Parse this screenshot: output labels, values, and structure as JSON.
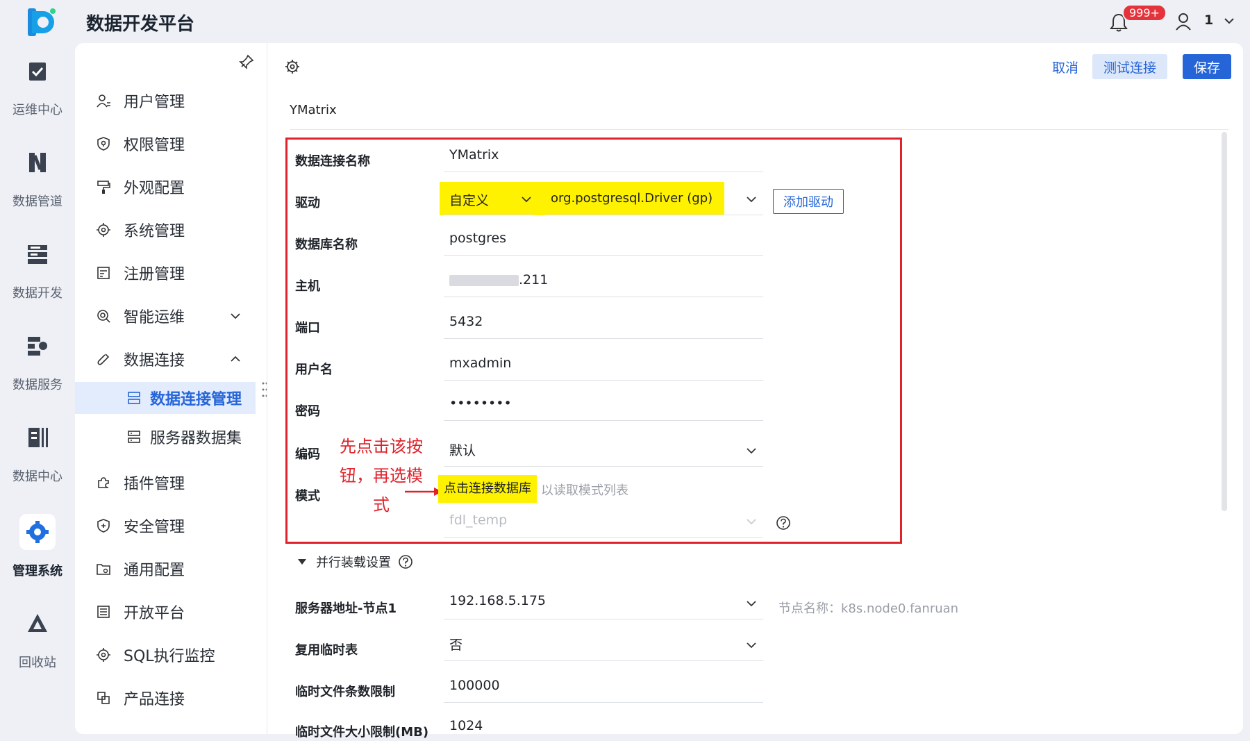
{
  "header": {
    "app_title": "数据开发平台",
    "notification_badge": "999+",
    "user_name": "1"
  },
  "rail": [
    {
      "label": "运维中心",
      "icon": "ops-center-icon"
    },
    {
      "label": "数据管道",
      "icon": "data-pipeline-icon"
    },
    {
      "label": "数据开发",
      "icon": "data-dev-icon"
    },
    {
      "label": "数据服务",
      "icon": "data-service-icon"
    },
    {
      "label": "数据中心",
      "icon": "data-center-icon"
    },
    {
      "label": "管理系统",
      "icon": "gear-icon",
      "active": true
    },
    {
      "label": "回收站",
      "icon": "recycle-icon"
    }
  ],
  "sidebar": {
    "items": [
      {
        "label": "用户管理",
        "icon": "user-manage-icon"
      },
      {
        "label": "权限管理",
        "icon": "permission-icon"
      },
      {
        "label": "外观配置",
        "icon": "paint-icon"
      },
      {
        "label": "系统管理",
        "icon": "gear-icon"
      },
      {
        "label": "注册管理",
        "icon": "register-icon"
      },
      {
        "label": "智能运维",
        "icon": "smart-ops-icon",
        "expand": "down"
      },
      {
        "label": "数据连接",
        "icon": "link-icon",
        "expand": "up"
      }
    ],
    "sub_items": [
      {
        "label": "数据连接管理",
        "icon": "connection-manage-icon",
        "active": true
      },
      {
        "label": "服务器数据集",
        "icon": "server-dataset-icon"
      }
    ],
    "items2": [
      {
        "label": "插件管理",
        "icon": "plugin-icon"
      },
      {
        "label": "安全管理",
        "icon": "shield-icon"
      },
      {
        "label": "通用配置",
        "icon": "folder-gear-icon"
      },
      {
        "label": "开放平台",
        "icon": "open-platform-icon"
      },
      {
        "label": "SQL执行监控",
        "icon": "gear-icon"
      },
      {
        "label": "产品连接",
        "icon": "product-link-icon"
      }
    ]
  },
  "toolbar": {
    "cancel_label": "取消",
    "test_label": "测试连接",
    "save_label": "保存"
  },
  "connection_title": "YMatrix",
  "form": {
    "name_label": "数据连接名称",
    "name_value": "YMatrix",
    "driver_label": "驱动",
    "driver_type": "自定义",
    "driver_class": "org.postgresql.Driver (gp)",
    "add_driver_label": "添加驱动",
    "db_label": "数据库名称",
    "db_value": "postgres",
    "host_label": "主机",
    "host_value_suffix": ".211",
    "port_label": "端口",
    "port_value": "5432",
    "user_label": "用户名",
    "user_value": "mxadmin",
    "password_label": "密码",
    "password_value": "••••••••",
    "encoding_label": "编码",
    "encoding_value": "默认",
    "schema_label": "模式",
    "connect_button_label": "点击连接数据库",
    "connect_hint": "以读取模式列表",
    "schema_value": "fdl_temp"
  },
  "annotation": {
    "note": "先点击该按钮，再选模式"
  },
  "parallel": {
    "section_label": "并行装载设置",
    "server_label": "服务器地址-节点1",
    "server_value": "192.168.5.175",
    "node_name": "节点名称：k8s.node0.fanruan",
    "reuse_label": "复用临时表",
    "reuse_value": "否",
    "row_limit_label": "临时文件条数限制",
    "row_limit_value": "100000",
    "size_limit_label": "临时文件大小限制(MB)",
    "size_limit_value": "1024"
  },
  "colors": {
    "primary": "#2665d8",
    "highlight_red": "#e0222b",
    "highlight_yellow": "#fff200"
  }
}
